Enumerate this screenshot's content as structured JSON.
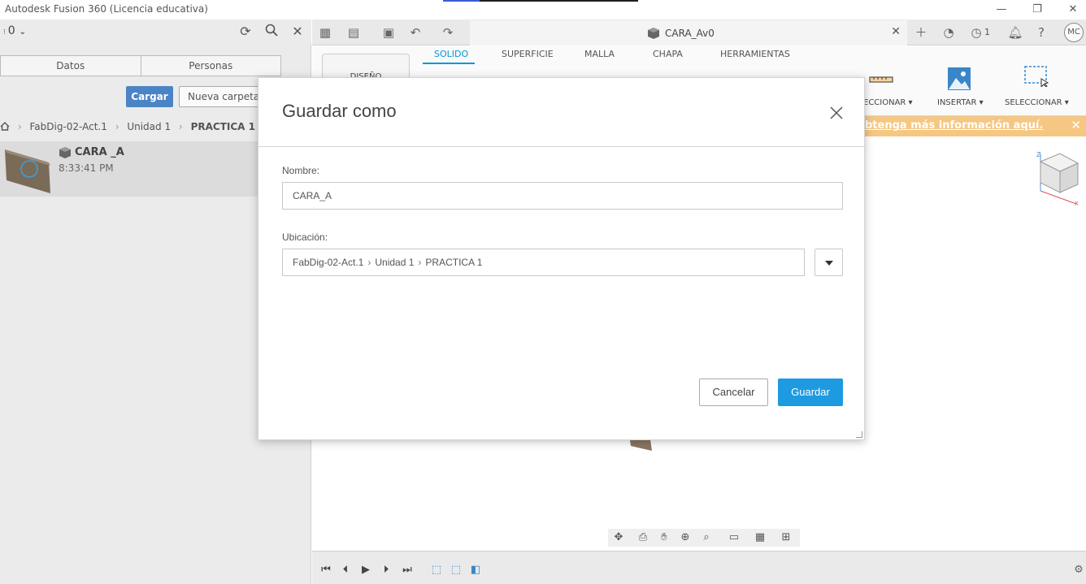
{
  "window": {
    "title": "Autodesk Fusion 360 (Licencia educativa)"
  },
  "left_panel": {
    "count": "0",
    "tabs": [
      {
        "label": "Datos"
      },
      {
        "label": "Personas"
      }
    ],
    "upload_label": "Cargar",
    "new_folder_label": "Nueva carpeta",
    "breadcrumb": [
      "FabDig-02-Act.1",
      "Unidad 1",
      "PRACTICA 1"
    ],
    "file": {
      "name": "CARA _A",
      "time": "8:33:41 PM"
    }
  },
  "document_tab": {
    "name": "CARA_Av0"
  },
  "top_right": {
    "jobs_count": "1",
    "avatar_initials": "MC"
  },
  "ribbon": {
    "workspace_label": "DISEÑO",
    "tabs": [
      {
        "label": "SOLIDO",
        "active": true
      },
      {
        "label": "SUPERFICIE",
        "active": false
      },
      {
        "label": "MALLA",
        "active": false
      },
      {
        "label": "CHAPA",
        "active": false
      },
      {
        "label": "HERRAMIENTAS",
        "active": false
      }
    ],
    "groups": [
      {
        "label": "ECCIONAR ▾"
      },
      {
        "label": "INSERTAR ▾"
      },
      {
        "label": "SELECCIONAR ▾"
      }
    ]
  },
  "banner": {
    "text": "btenga más información aquí."
  },
  "dialog": {
    "title": "Guardar como",
    "name_label": "Nombre:",
    "name_value": "CARA_A",
    "location_label": "Ubicación:",
    "location_path": [
      "FabDig-02-Act.1",
      "Unidad 1",
      "PRACTICA 1"
    ],
    "cancel_label": "Cancelar",
    "save_label": "Guardar"
  },
  "colors": {
    "accent_blue": "#1e9ae0",
    "upload_blue": "#4b84c4",
    "banner_orange": "#f5c783",
    "ribbon_active": "#0696d7"
  }
}
